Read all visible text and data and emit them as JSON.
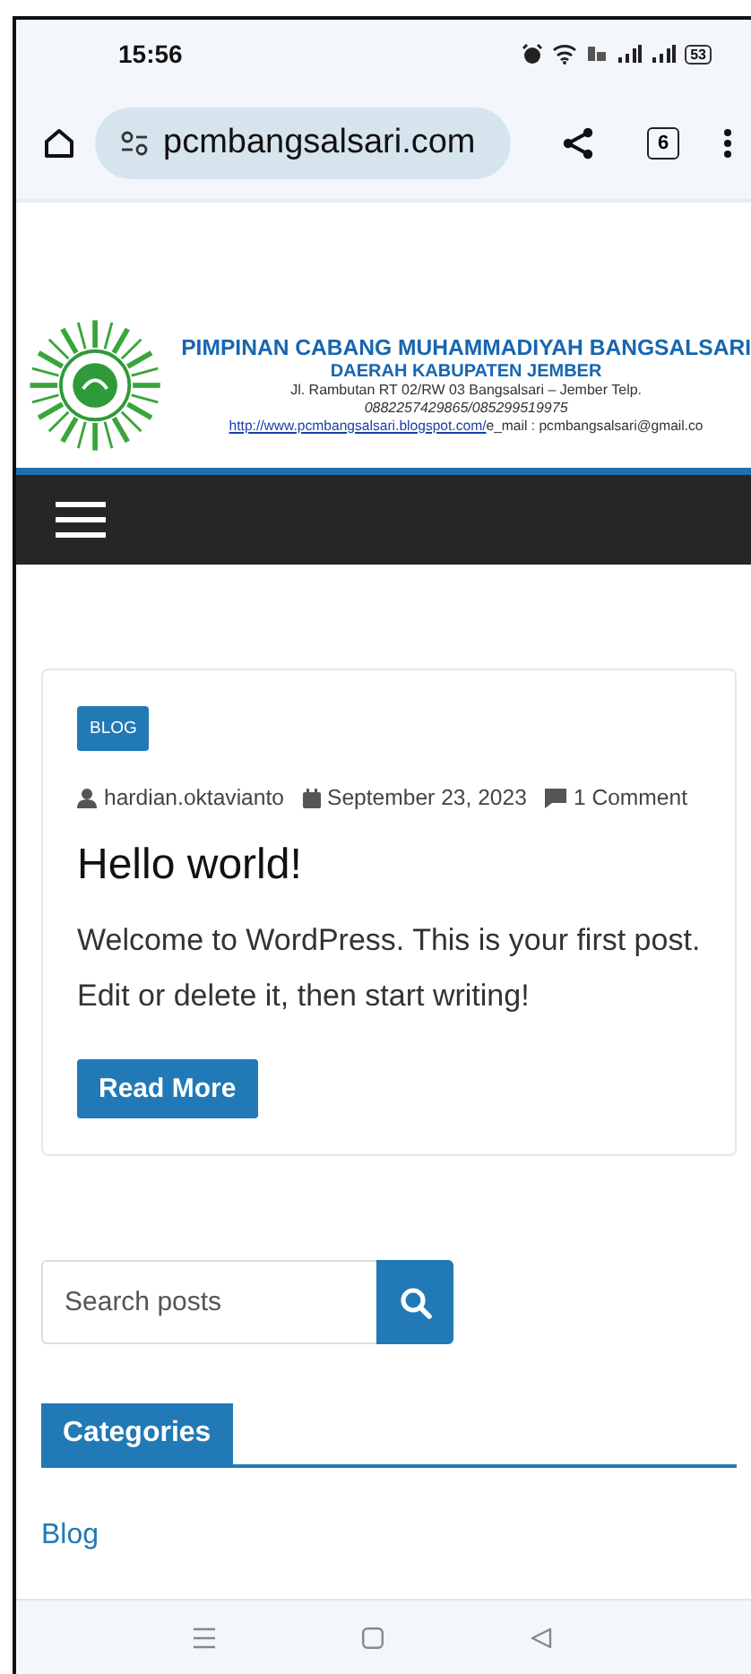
{
  "status_bar": {
    "time": "15:56",
    "battery": "53"
  },
  "browser": {
    "url": "pcmbangsalsari.com",
    "tab_count": "6"
  },
  "site_header": {
    "title": "PIMPINAN CABANG MUHAMMADIYAH BANGSALSARI",
    "subtitle": "DAERAH KABUPATEN JEMBER",
    "address": "Jl. Rambutan RT 02/RW 03 Bangsalsari – Jember Telp.",
    "phone": "0882257429865/085299519975",
    "link": "http://www.pcmbangsalsari.blogspot.com/",
    "email": "e_mail : pcmbangsalsari@gmail.co"
  },
  "post": {
    "category": "BLOG",
    "author": "hardian.oktavianto",
    "date": "September 23, 2023",
    "comments": "1 Comment",
    "title": "Hello world!",
    "excerpt": "Welcome to WordPress. This is your first post. Edit or delete it, then start writing!",
    "button": "Read More"
  },
  "search": {
    "placeholder": "Search posts"
  },
  "categories": {
    "heading": "Categories",
    "items": [
      {
        "label": "Blog"
      }
    ]
  }
}
